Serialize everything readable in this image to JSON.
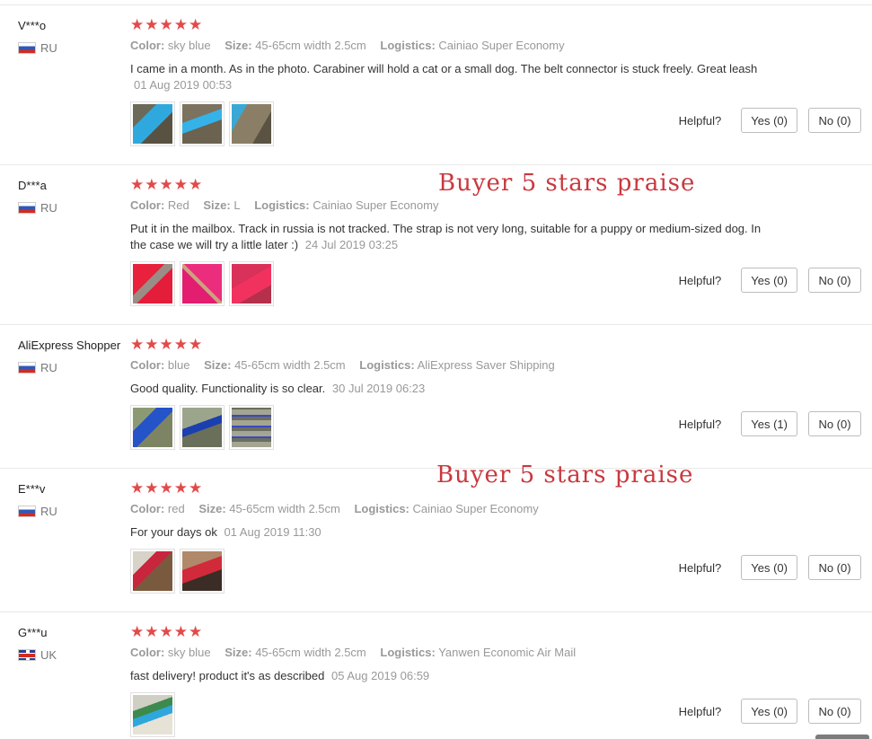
{
  "labels": {
    "color_key": "Color:",
    "size_key": "Size:",
    "logistics_key": "Logistics:",
    "helpful": "Helpful?"
  },
  "overlay": {
    "praise_1": "Buyer 5 stars praise",
    "praise_2": "Buyer 5 stars praise"
  },
  "colors": {
    "star": "#e24a4a",
    "praise_text": "#c9383e",
    "muted_text": "#999999"
  },
  "reviews": [
    {
      "user": "V***o",
      "country": "RU",
      "flag": "flag-russia",
      "stars": "★★★★★",
      "color": "sky blue",
      "size": "45-65cm width 2.5cm",
      "logistics": "Cainiao Super Economy",
      "text": "I came in a month. As in the photo. Carabiner will hold a cat or a small dog. The belt connector is stuck freely. Great leash",
      "date": "01 Aug 2019 00:53",
      "yes": "Yes (0)",
      "no": "No (0)"
    },
    {
      "user": "D***a",
      "country": "RU",
      "flag": "flag-russia",
      "stars": "★★★★★",
      "color": "Red",
      "size": "L",
      "logistics": "Cainiao Super Economy",
      "text": "Put it in the mailbox. Track in russia is not tracked. The strap is not very long, suitable for a puppy or medium-sized dog. In the case we will try a little later :)",
      "date": "24 Jul 2019 03:25",
      "yes": "Yes (0)",
      "no": "No (0)"
    },
    {
      "user": "AliExpress Shopper",
      "country": "RU",
      "flag": "flag-russia",
      "stars": "★★★★★",
      "color": "blue",
      "size": "45-65cm width 2.5cm",
      "logistics": "AliExpress Saver Shipping",
      "text": "Good quality. Functionality is so clear.",
      "date": "30 Jul 2019 06:23",
      "yes": "Yes (1)",
      "no": "No (0)"
    },
    {
      "user": "E***v",
      "country": "RU",
      "flag": "flag-russia",
      "stars": "★★★★★",
      "color": "red",
      "size": "45-65cm width 2.5cm",
      "logistics": "Cainiao Super Economy",
      "text": "For your days ok",
      "date": "01 Aug 2019 11:30",
      "yes": "Yes (0)",
      "no": "No (0)"
    },
    {
      "user": "G***u",
      "country": "UK",
      "flag": "flag-uk",
      "stars": "★★★★★",
      "color": "sky blue",
      "size": "45-65cm width 2.5cm",
      "logistics": "Yanwen Economic Air Mail",
      "text": "fast delivery! product it's as described",
      "date": "05 Aug 2019 06:59",
      "yes": "Yes (0)",
      "no": "No (0)"
    }
  ]
}
